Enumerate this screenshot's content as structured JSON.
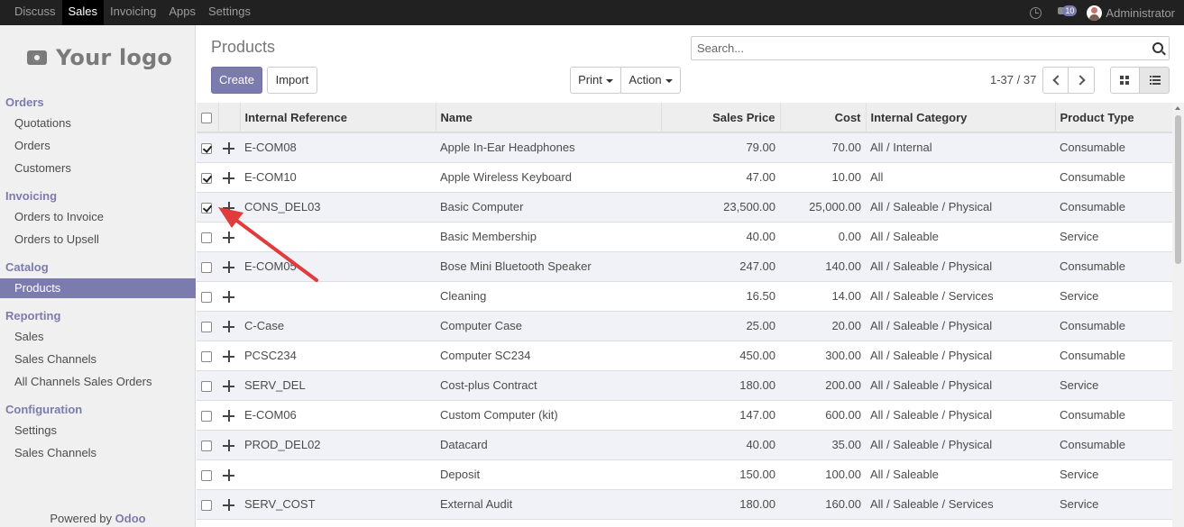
{
  "topbar": {
    "menu": [
      "Discuss",
      "Sales",
      "Invoicing",
      "Apps",
      "Settings"
    ],
    "active_menu": "Sales",
    "message_count": "10",
    "user_name": "Administrator"
  },
  "sidebar": {
    "logo_text": "Your logo",
    "sections": [
      {
        "title": "Orders",
        "items": [
          "Quotations",
          "Orders",
          "Customers"
        ]
      },
      {
        "title": "Invoicing",
        "items": [
          "Orders to Invoice",
          "Orders to Upsell"
        ]
      },
      {
        "title": "Catalog",
        "items": [
          "Products"
        ]
      },
      {
        "title": "Reporting",
        "items": [
          "Sales",
          "Sales Channels",
          "All Channels Sales Orders"
        ]
      },
      {
        "title": "Configuration",
        "items": [
          "Settings",
          "Sales Channels"
        ]
      }
    ],
    "active_item": "Products",
    "powered_by": "Powered by",
    "powered_brand": "Odoo"
  },
  "control": {
    "title": "Products",
    "search_placeholder": "Search...",
    "create_label": "Create",
    "import_label": "Import",
    "print_label": "Print",
    "action_label": "Action",
    "pager": "1-37 / 37"
  },
  "table": {
    "columns": [
      "Internal Reference",
      "Name",
      "Sales Price",
      "Cost",
      "Internal Category",
      "Product Type"
    ],
    "rows": [
      {
        "checked": true,
        "ref": "E-COM08",
        "name": "Apple In-Ear Headphones",
        "price": "79.00",
        "cost": "70.00",
        "category": "All / Internal",
        "type": "Consumable"
      },
      {
        "checked": true,
        "ref": "E-COM10",
        "name": "Apple Wireless Keyboard",
        "price": "47.00",
        "cost": "10.00",
        "category": "All",
        "type": "Consumable"
      },
      {
        "checked": true,
        "ref": "CONS_DEL03",
        "name": "Basic Computer",
        "price": "23,500.00",
        "cost": "25,000.00",
        "category": "All / Saleable / Physical",
        "type": "Consumable"
      },
      {
        "checked": false,
        "ref": "",
        "name": "Basic Membership",
        "price": "40.00",
        "cost": "0.00",
        "category": "All / Saleable",
        "type": "Service"
      },
      {
        "checked": false,
        "ref": "E-COM05",
        "name": "Bose Mini Bluetooth Speaker",
        "price": "247.00",
        "cost": "140.00",
        "category": "All / Saleable / Physical",
        "type": "Consumable"
      },
      {
        "checked": false,
        "ref": "",
        "name": "Cleaning",
        "price": "16.50",
        "cost": "14.00",
        "category": "All / Saleable / Services",
        "type": "Service"
      },
      {
        "checked": false,
        "ref": "C-Case",
        "name": "Computer Case",
        "price": "25.00",
        "cost": "20.00",
        "category": "All / Saleable / Physical",
        "type": "Consumable"
      },
      {
        "checked": false,
        "ref": "PCSC234",
        "name": "Computer SC234",
        "price": "450.00",
        "cost": "300.00",
        "category": "All / Saleable / Physical",
        "type": "Consumable"
      },
      {
        "checked": false,
        "ref": "SERV_DEL",
        "name": "Cost-plus Contract",
        "price": "180.00",
        "cost": "200.00",
        "category": "All / Saleable / Physical",
        "type": "Service"
      },
      {
        "checked": false,
        "ref": "E-COM06",
        "name": "Custom Computer (kit)",
        "price": "147.00",
        "cost": "600.00",
        "category": "All / Saleable / Physical",
        "type": "Consumable"
      },
      {
        "checked": false,
        "ref": "PROD_DEL02",
        "name": "Datacard",
        "price": "40.00",
        "cost": "35.00",
        "category": "All / Saleable / Physical",
        "type": "Consumable"
      },
      {
        "checked": false,
        "ref": "",
        "name": "Deposit",
        "price": "150.00",
        "cost": "100.00",
        "category": "All / Saleable",
        "type": "Service"
      },
      {
        "checked": false,
        "ref": "SERV_COST",
        "name": "External Audit",
        "price": "180.00",
        "cost": "160.00",
        "category": "All / Saleable / Services",
        "type": "Service"
      },
      {
        "checked": false,
        "ref": "",
        "name": "",
        "price": "",
        "cost": "",
        "category": "",
        "type": ""
      }
    ]
  },
  "colors": {
    "accent": "#7c7bad",
    "annotation_arrow": "#e03c3c"
  }
}
